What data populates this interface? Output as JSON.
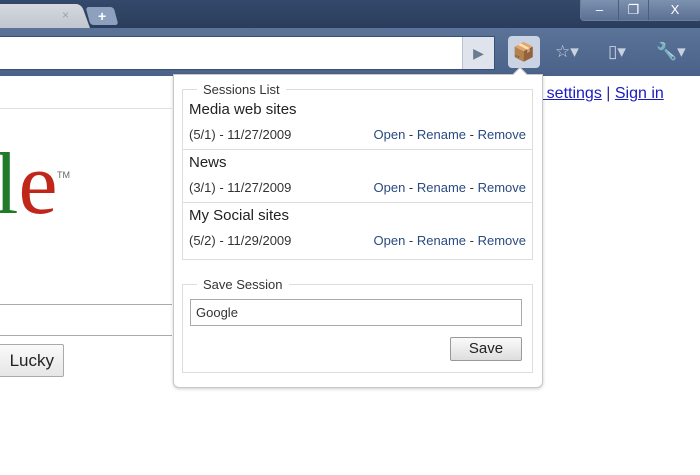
{
  "browser": {
    "tab_close": "×",
    "new_tab": "+",
    "window_buttons": {
      "minimize": "–",
      "restore": "❐",
      "close": "X"
    },
    "go": "▶"
  },
  "page": {
    "top_links": {
      "partial": "rch settings",
      "sep": " | ",
      "sign_in": "Sign in"
    },
    "logo": {
      "l": "l",
      "e": "e",
      "tm": "TM"
    },
    "lucky": "Lucky"
  },
  "popup": {
    "sessions_legend": "Sessions List",
    "sessions": [
      {
        "name": "Media web sites",
        "meta": "(5/1) - 11/27/2009"
      },
      {
        "name": "News",
        "meta": "(3/1) - 11/27/2009"
      },
      {
        "name": "My Social sites",
        "meta": "(5/2) - 11/29/2009"
      }
    ],
    "actions": {
      "open": "Open",
      "rename": "Rename",
      "remove": "Remove",
      "sep": " - "
    },
    "save_legend": "Save Session",
    "save_value": "Google",
    "save_button": "Save"
  }
}
